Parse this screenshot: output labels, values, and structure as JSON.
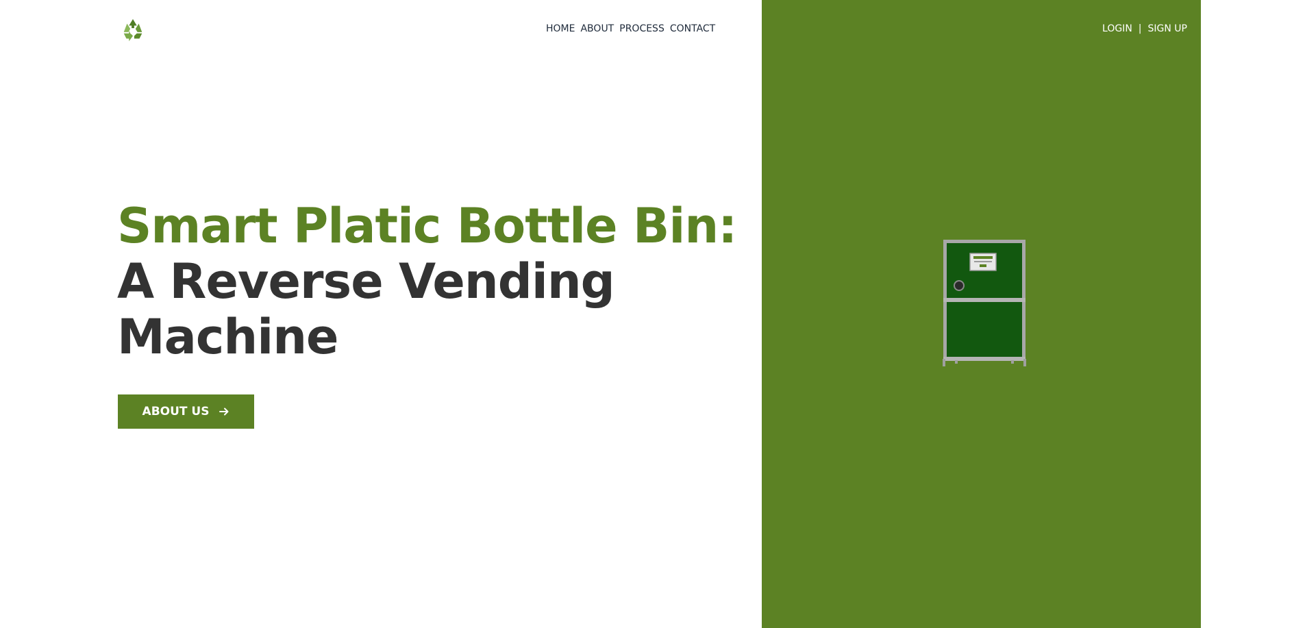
{
  "header": {
    "logo_icon": "recycle-icon",
    "nav": [
      {
        "label": "HOME"
      },
      {
        "label": "ABOUT"
      },
      {
        "label": "PROCESS"
      },
      {
        "label": "CONTACT"
      }
    ],
    "auth": {
      "login_label": "LOGIN",
      "separator": "|",
      "signup_label": "SIGN UP"
    }
  },
  "hero": {
    "title_accent": "Smart Platic Bottle Bin:",
    "title_rest": "A Reverse Vending Machine",
    "cta_label": "ABOUT US",
    "cta_icon": "arrow-right-icon"
  },
  "illustration": {
    "icon": "reverse-vending-machine-illustration"
  },
  "colors": {
    "brand_green": "#5c8224",
    "machine_green": "#12580f",
    "heading_dark": "#333333",
    "nav_text": "#1e2a3a"
  }
}
